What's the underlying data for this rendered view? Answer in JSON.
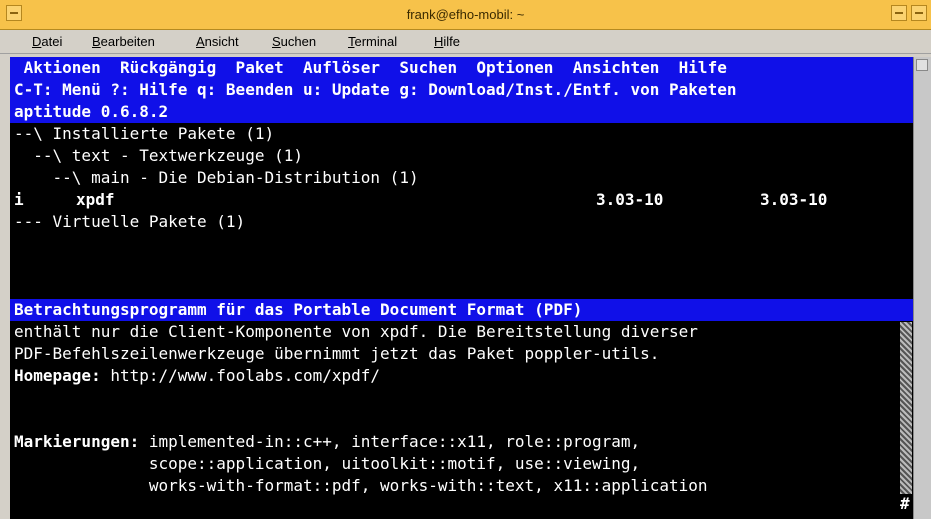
{
  "window": {
    "title": "frank@efho-mobil: ~"
  },
  "menubar": [
    {
      "key": "D",
      "rest": "atei"
    },
    {
      "key": "B",
      "rest": "earbeiten"
    },
    {
      "key": "A",
      "rest": "nsicht"
    },
    {
      "key": "S",
      "rest": "uchen"
    },
    {
      "key": "T",
      "rest": "erminal"
    },
    {
      "key": "H",
      "rest": "ilfe"
    }
  ],
  "terminal": {
    "menu": " Aktionen  Rückgängig  Paket  Auflöser  Suchen  Optionen  Ansichten  Hilfe",
    "keys": "C-T: Menü ?: Hilfe q: Beenden u: Update g: Download/Inst./Entf. von Paketen",
    "version": "aptitude 0.6.8.2",
    "tree": [
      "--\\ Installierte Pakete (1)",
      "  --\\ text - Textwerkzeuge (1)",
      "    --\\ main - Die Debian-Distribution (1)"
    ],
    "package": {
      "state": "i",
      "name": "xpdf",
      "installed": "3.03-10",
      "candidate": "3.03-10"
    },
    "virtual": "--- Virtuelle Pakete (1)",
    "desc_title": "Betrachtungsprogramm für das Portable Document Format (PDF)",
    "desc_lines": [
      "enthält nur die Client-Komponente von xpdf. Die Bereitstellung diverser",
      "PDF-Befehlszeilenwerkzeuge übernimmt jetzt das Paket poppler-utils."
    ],
    "homepage_label": "Homepage:",
    "homepage_url": " http://www.foolabs.com/xpdf/",
    "tags_label": "Markierungen:",
    "tags_lines": [
      " implemented-in::c++, interface::x11, role::program,",
      "              scope::application, uitoolkit::motif, use::viewing,",
      "              works-with-format::pdf, works-with::text, x11::application"
    ],
    "scroll_marker": "#"
  }
}
